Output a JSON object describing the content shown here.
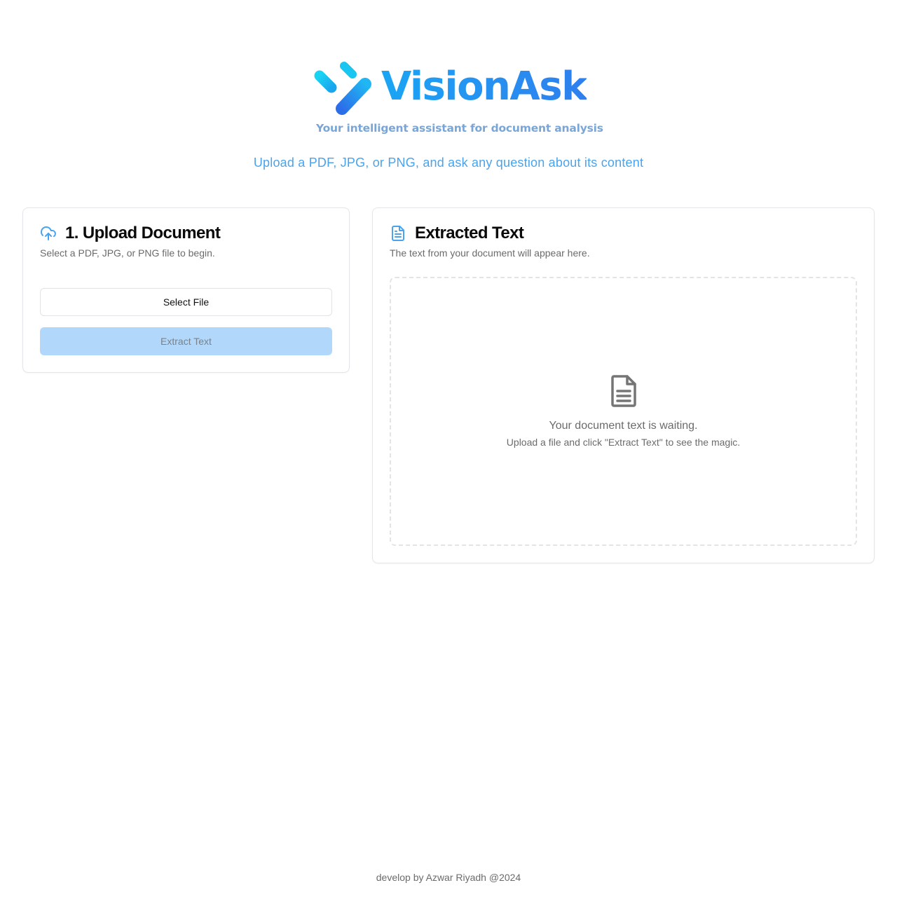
{
  "brand": {
    "name": "VisionAsk",
    "tagline": "Your intelligent  assistant for document analysis",
    "logo_icon": "checkmark-pill-logo-icon"
  },
  "subtitle": "Upload a PDF, JPG, or PNG, and ask any question about its content",
  "upload_card": {
    "icon": "cloud-upload-icon",
    "title": "1. Upload Document",
    "description": "Select a PDF, JPG, or PNG file to begin.",
    "select_button": "Select File",
    "extract_button": "Extract Text",
    "extract_disabled": true
  },
  "text_card": {
    "icon": "document-icon",
    "title": "Extracted Text",
    "description": "The text from your document will appear here.",
    "empty_icon": "document-icon",
    "empty_title": "Your document text is waiting.",
    "empty_hint": "Upload a file and click \"Extract Text\" to see the magic."
  },
  "footer": "develop by Azwar Riyadh @2024",
  "colors": {
    "accent": "#4aa3ec",
    "brand_gradient_start": "#1ba5f4",
    "brand_gradient_end": "#2f7fee",
    "disabled_button": "#b1d8fb"
  }
}
